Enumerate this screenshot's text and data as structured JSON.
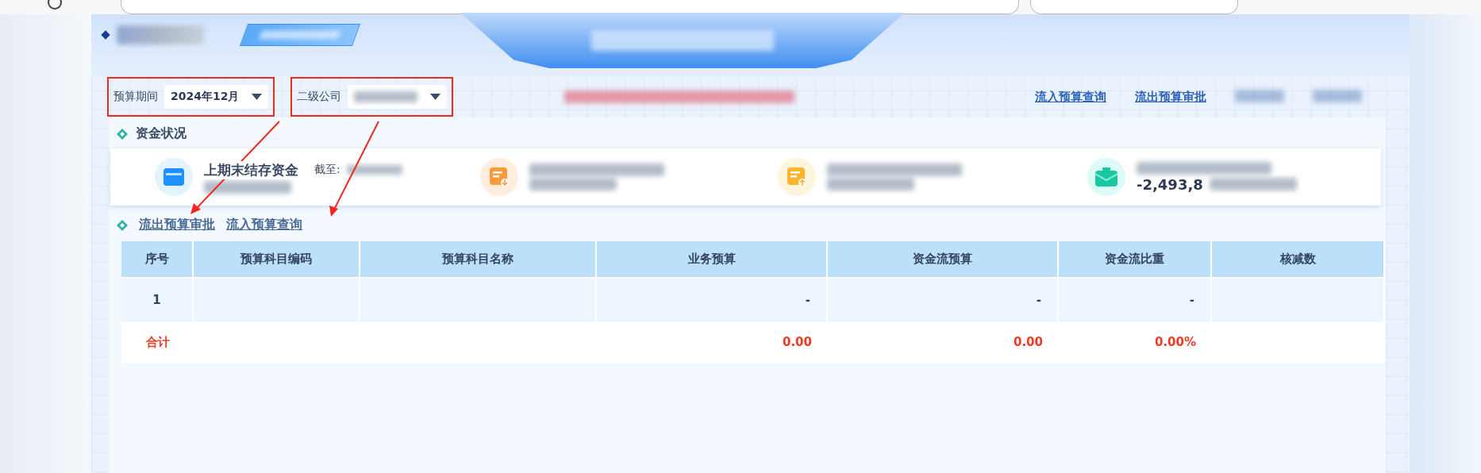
{
  "filters": [
    {
      "label": "预算期间",
      "value": "2024年12月",
      "highlighted": true,
      "value_blurred": false
    },
    {
      "label": "二级公司",
      "highlighted": true,
      "value_blurred": true
    }
  ],
  "nav_links": [
    {
      "label": "流入预算查询",
      "blurred": false
    },
    {
      "label": "流出预算审批",
      "blurred": false
    },
    {
      "blurred": true
    },
    {
      "blurred": true
    }
  ],
  "section": {
    "title": "资金状况"
  },
  "stats": [
    {
      "kind": "wallet",
      "label": "上期末结存资金",
      "note": "截至:"
    },
    {
      "kind": "doc-down"
    },
    {
      "kind": "doc-up"
    },
    {
      "kind": "mail",
      "value": "-2,493,8"
    }
  ],
  "links": [
    {
      "label": "流出预算审批",
      "arrowed": true
    },
    {
      "label": "流入预算查询",
      "arrowed": true
    }
  ],
  "table": {
    "columns": [
      "序号",
      "预算科目编码",
      "预算科目名称",
      "业务预算",
      "资金流预算",
      "资金流比重",
      "核减数"
    ],
    "rows": [
      {
        "index": "1",
        "business": "-",
        "cash_flow": "-",
        "ratio": "-"
      }
    ],
    "total": {
      "label": "合计",
      "business": "0.00",
      "cash_flow": "0.00",
      "ratio": "0.00%"
    }
  }
}
